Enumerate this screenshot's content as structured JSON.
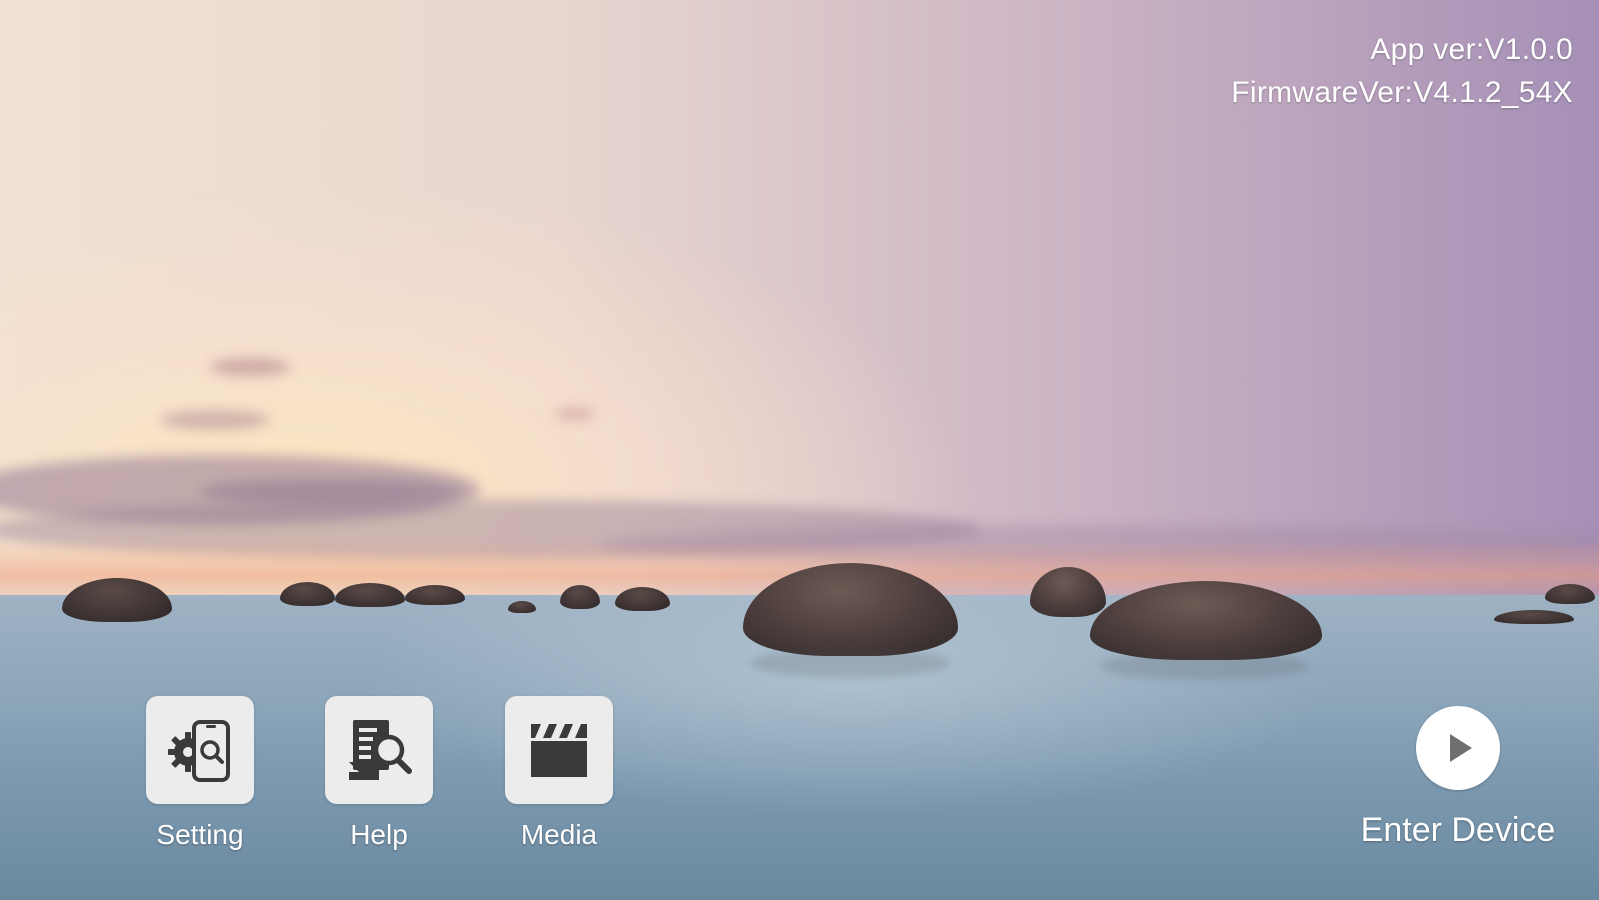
{
  "version_info": {
    "app_version": "App ver:V1.0.0",
    "firmware_version": "FirmwareVer:V4.1.2_54X"
  },
  "menu": {
    "items": [
      {
        "label": "Setting",
        "icon": "settings-search-icon"
      },
      {
        "label": "Help",
        "icon": "help-document-search-icon"
      },
      {
        "label": "Media",
        "icon": "clapperboard-icon"
      }
    ]
  },
  "enter_device": {
    "label": "Enter Device",
    "icon": "play-circle-icon"
  },
  "colors": {
    "tile_background": "#ececec",
    "icon_color": "#3a3a3a",
    "text_color": "#ffffff",
    "play_icon_color": "#6f6f6f"
  }
}
